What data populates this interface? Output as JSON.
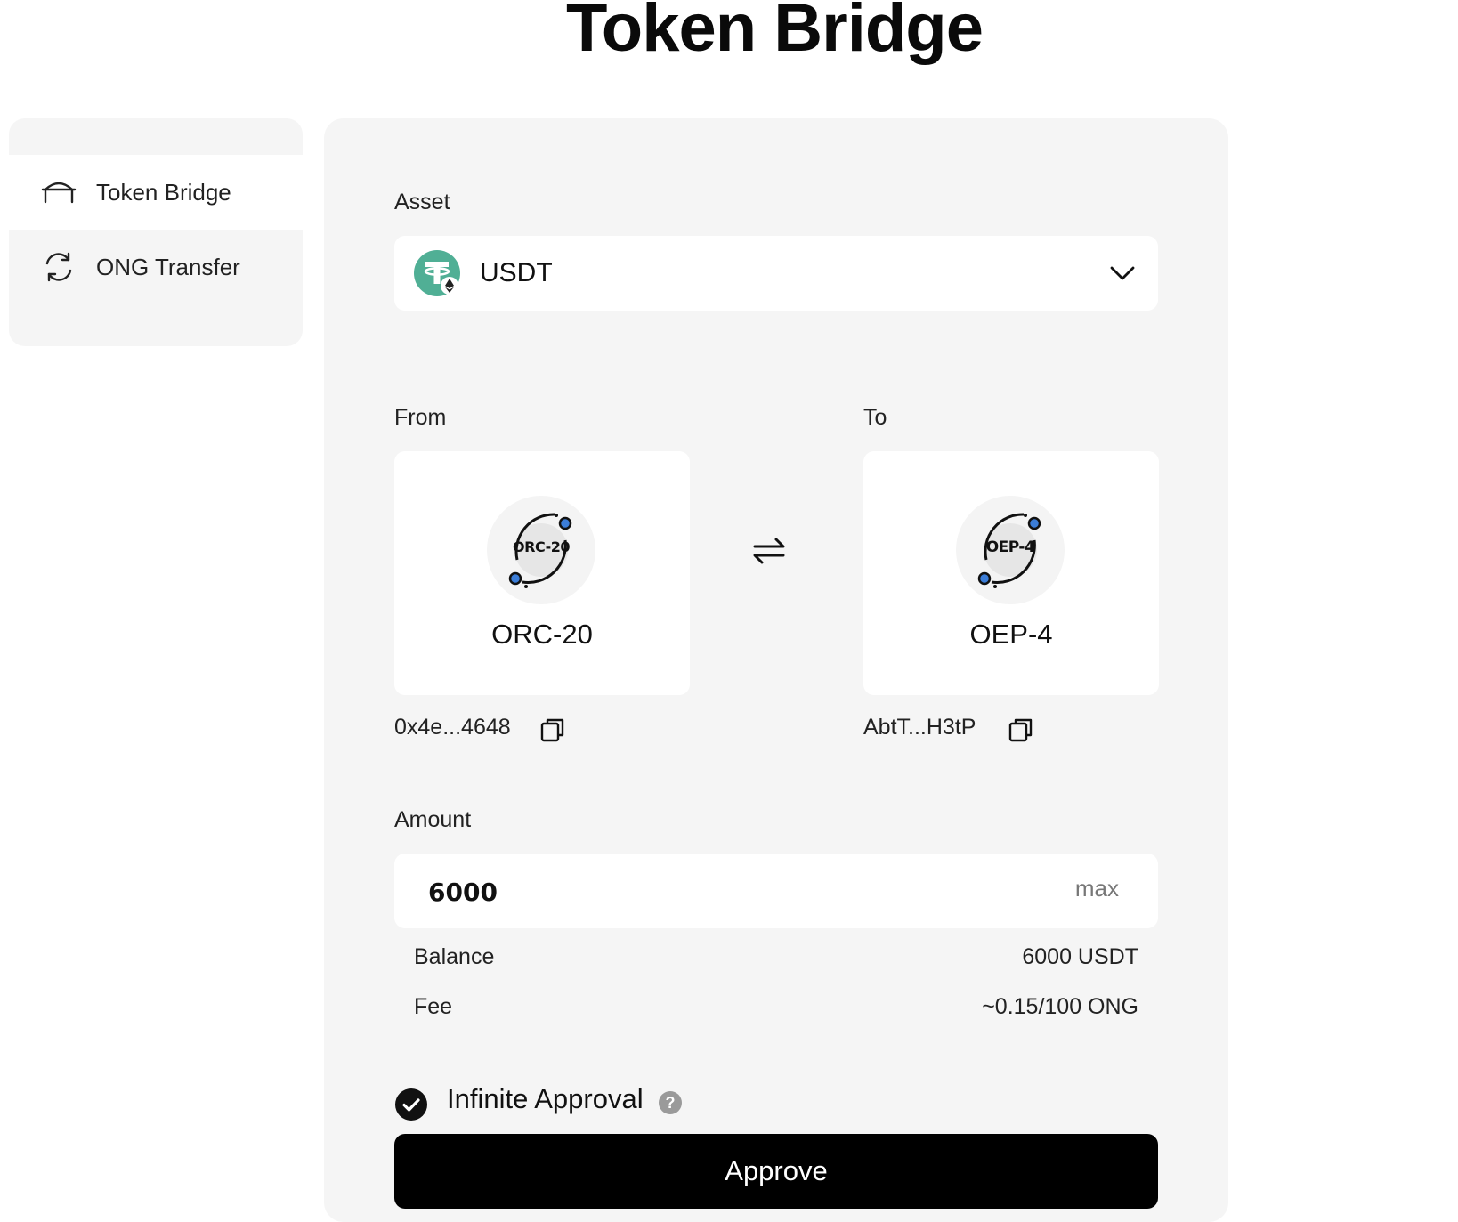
{
  "page": {
    "title": "Token Bridge"
  },
  "sidebar": {
    "items": [
      {
        "label": "Token Bridge",
        "icon": "bridge-icon",
        "active": true
      },
      {
        "label": "ONG Transfer",
        "icon": "refresh-icon",
        "active": false
      }
    ]
  },
  "form": {
    "asset_label": "Asset",
    "asset": {
      "symbol": "USDT",
      "icon": "tether-icon",
      "color": "#50af95"
    },
    "from_label": "From",
    "to_label": "To",
    "from": {
      "badge": "ORC-20",
      "name": "ORC-20",
      "address": "0x4e...4648"
    },
    "to": {
      "badge": "OEP-4",
      "name": "OEP-4",
      "address": "AbtT...H3tP"
    },
    "amount_label": "Amount",
    "amount_value": "6000",
    "max_label": "max",
    "balance_label": "Balance",
    "balance_value": "6000 USDT",
    "fee_label": "Fee",
    "fee_value": "~0.15/100 ONG",
    "infinite_approval_label": "Infinite Approval",
    "help_glyph": "?",
    "approve_label": "Approve"
  }
}
